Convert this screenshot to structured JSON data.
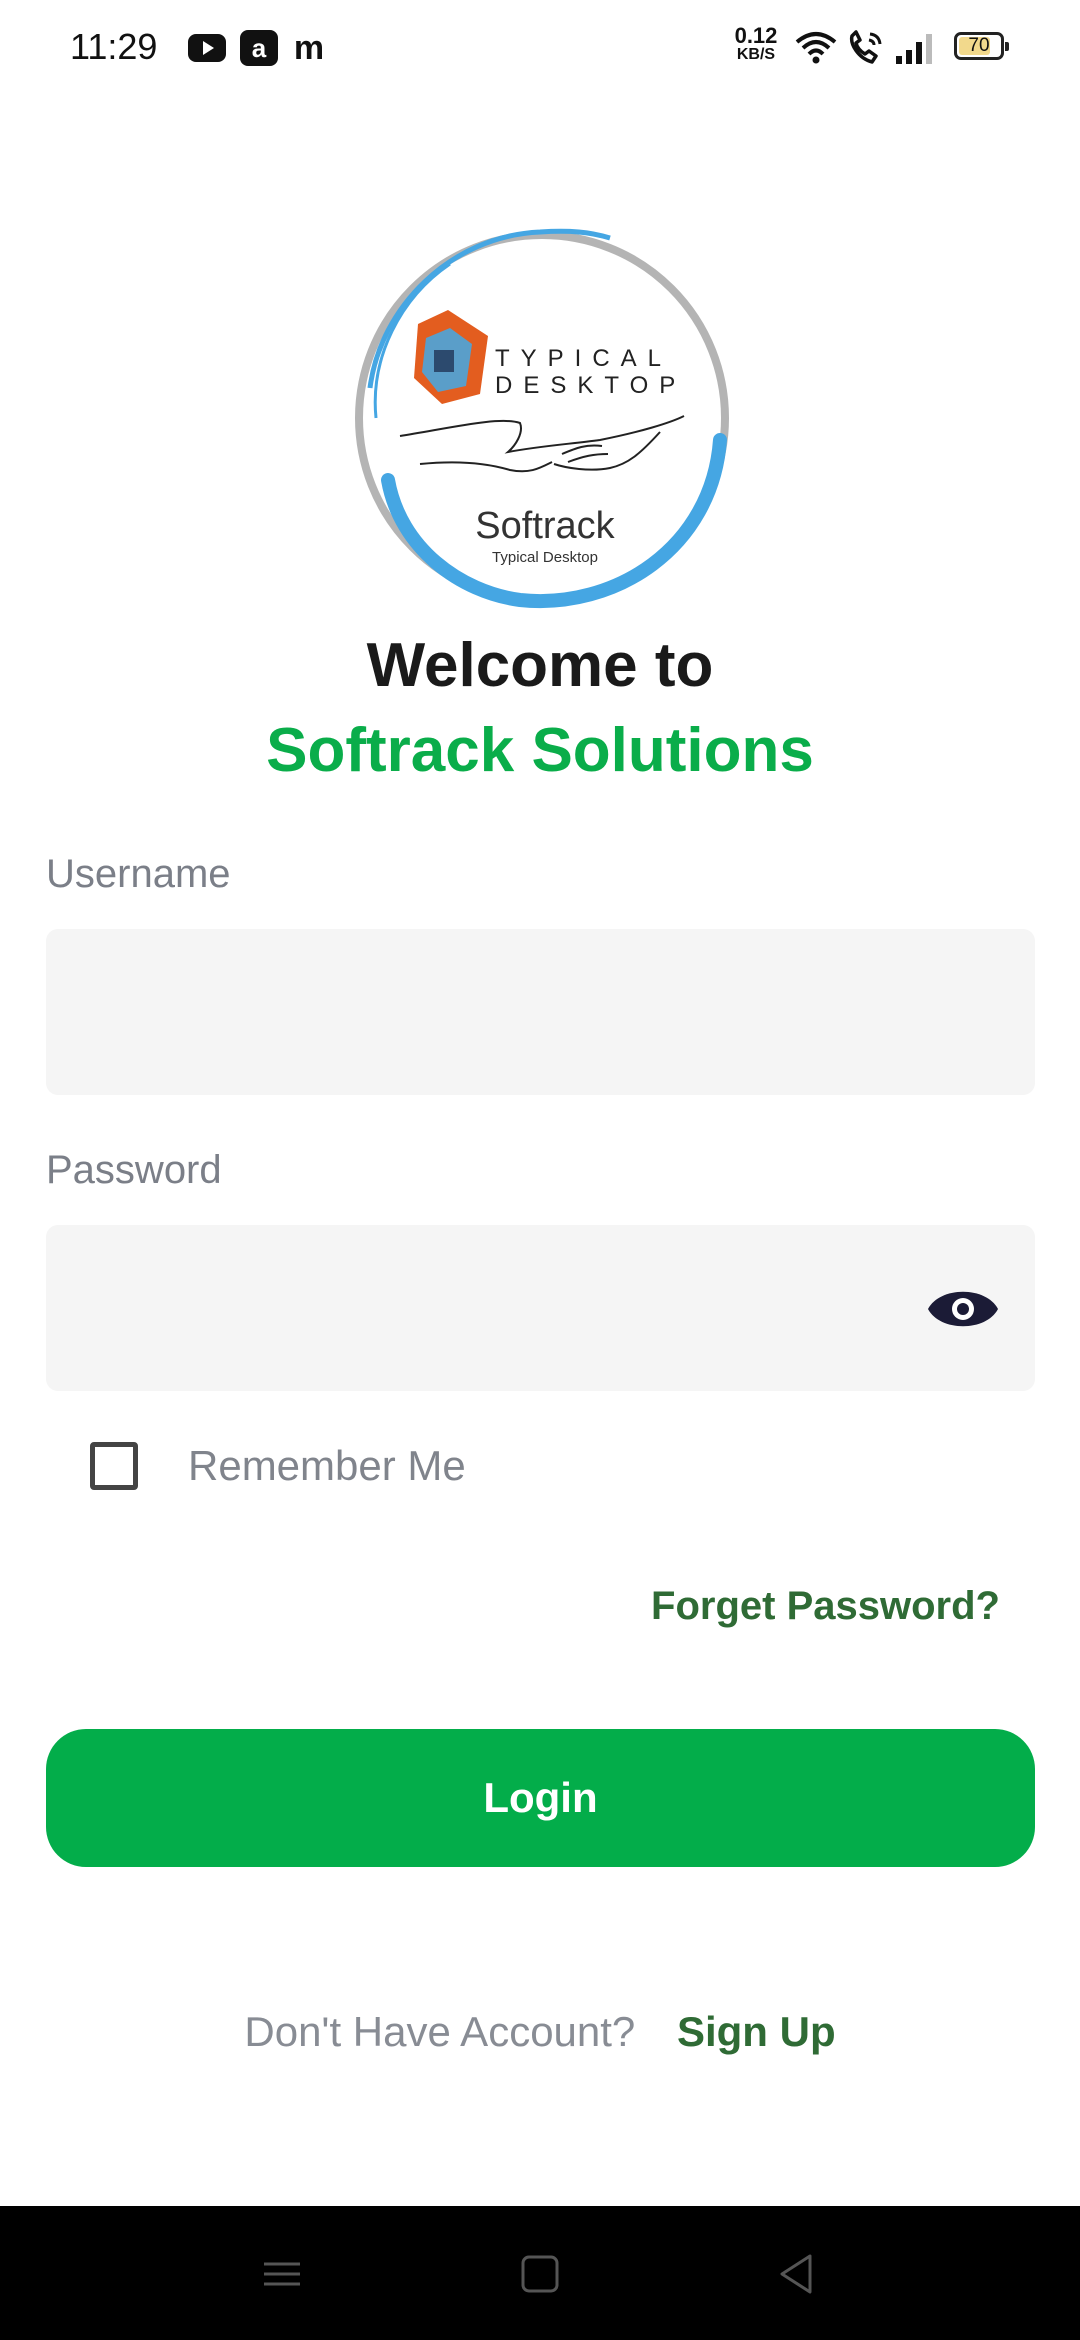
{
  "status_bar": {
    "time": "11:29",
    "notification_icons": [
      "youtube-icon",
      "a-app-icon",
      "m-app-icon"
    ],
    "a_app_glyph": "a",
    "m_app_glyph": "m",
    "net_speed_value": "0.12",
    "net_speed_unit": "KB/S",
    "battery_level": "70"
  },
  "logo": {
    "line1": "TYPICAL",
    "line2": "DESKTOP",
    "name": "Softrack",
    "tagline": "Typical Desktop"
  },
  "header": {
    "welcome": "Welcome to",
    "brand": "Softrack Solutions"
  },
  "form": {
    "username_label": "Username",
    "username_value": "",
    "password_label": "Password",
    "password_value": "",
    "remember_label": "Remember Me",
    "remember_checked": false,
    "forgot_label": "Forget Password?",
    "login_label": "Login"
  },
  "footer": {
    "prompt": "Don't Have Account?",
    "signup_label": "Sign Up"
  },
  "colors": {
    "brand_green": "#0aad4a",
    "button_green": "#03ad4a",
    "link_green": "#2f6b35",
    "field_bg": "#f5f5f5"
  }
}
